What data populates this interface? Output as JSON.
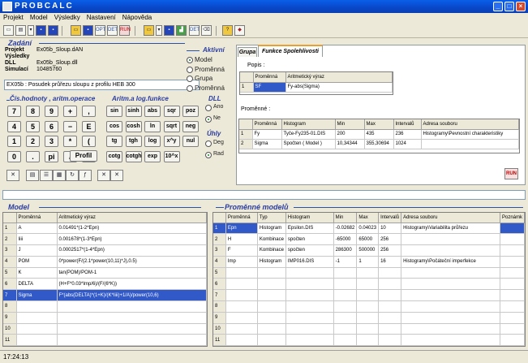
{
  "window": {
    "title": "PROBCALC",
    "min": "_",
    "max": "□",
    "close": "×"
  },
  "menu": [
    "Projekt",
    "Model",
    "Výsledky",
    "Nastavení",
    "Nápověda"
  ],
  "toolbar": [
    "new",
    "open",
    "dropdown",
    "save",
    "saveall",
    "open-folder",
    "save2",
    "opt",
    "det",
    "run",
    "folder2",
    "dropdown2",
    "save3",
    "chart",
    "det2",
    "clear",
    "help",
    "book"
  ],
  "toolbar_labels": {
    "opt": "OPT",
    "det": "DET",
    "run": "RUN",
    "det2": "DET"
  },
  "zadani": {
    "heading": "Zadání",
    "rows": [
      {
        "label": "Projekt",
        "value": "Ex05b_Sloup.dAN"
      },
      {
        "label": "Výsledky",
        "value": ""
      },
      {
        "label": "DLL",
        "value": "Ex05b_Sloup.dll"
      },
      {
        "label": "Simulací",
        "value": "10485760"
      }
    ],
    "description": "EX05b : Posudek průřezu sloupu z profilu HEB 300"
  },
  "aktivni": {
    "heading": "Aktivní",
    "options": [
      {
        "label": "Model",
        "on": true
      },
      {
        "label": "Proměnná",
        "on": false
      },
      {
        "label": "Grupa",
        "on": false
      },
      {
        "label": "Proměnná",
        "on": false
      }
    ]
  },
  "calc": {
    "heading": "Čís.hodnoty , aritm.operace",
    "keys": [
      "7",
      "8",
      "9",
      "+",
      ",",
      "4",
      "5",
      "6",
      "−",
      "E",
      "1",
      "2",
      "3",
      "*",
      "(",
      "0",
      ".",
      "pi",
      "/",
      ")"
    ],
    "profil": "Profil"
  },
  "funcs": {
    "heading": "Aritm.a log.funkce",
    "keys": [
      "sin",
      "sinh",
      "abs",
      "sqr",
      "poz",
      "cos",
      "cosh",
      "ln",
      "sqrt",
      "neg",
      "tg",
      "tgh",
      "log",
      "x^y",
      "nul",
      "cotg",
      "cotgh",
      "exp",
      "10^x"
    ]
  },
  "dll": {
    "heading": "DLL",
    "options": [
      {
        "label": "Ano",
        "on": false
      },
      {
        "label": "Ne",
        "on": true
      }
    ]
  },
  "uhly": {
    "heading": "Úhly",
    "options": [
      {
        "label": "Deg",
        "on": false
      },
      {
        "label": "Rad",
        "on": true
      }
    ]
  },
  "tabs": {
    "grupa": "Grupa",
    "funkce": "Funkce Spolehlivosti"
  },
  "popis": {
    "label": "Popis :",
    "headers": [
      "Proměnná",
      "Aritmetický výraz"
    ],
    "rows": [
      {
        "n": "1",
        "var": "SF",
        "expr": "Fy-abs(Sigma)"
      }
    ]
  },
  "promenne": {
    "label": "Proměnné :",
    "headers": [
      "Proměnná",
      "Histogram",
      "Min",
      "Max",
      "Intervalů",
      "Adresa souboru"
    ],
    "rows": [
      {
        "n": "1",
        "var": "Fy",
        "hist": "Tyče-Fy235-01.DIS",
        "min": "200",
        "max": "435",
        "int": "236",
        "addr": "Histogramy\\Pevnostní charakteristiky"
      },
      {
        "n": "2",
        "var": "Sigma",
        "hist": "Spočten ( Model )",
        "min": "10,34344",
        "max": "355,30694",
        "int": "1024",
        "addr": ""
      }
    ]
  },
  "run_label": "RUN",
  "model": {
    "heading": "Model",
    "headers": [
      "Proměnná",
      "Aritmetický výraz"
    ],
    "rows": [
      {
        "n": "1",
        "var": "A",
        "expr": "0.01491*(1-2*Epn)"
      },
      {
        "n": "2",
        "var": "Iiii",
        "expr": "0.001678*(1-3*Epn)"
      },
      {
        "n": "3",
        "var": "J",
        "expr": "0.0002517*(1-4*Epn)"
      },
      {
        "n": "4",
        "var": "POM",
        "expr": "0*power(F/(2.1*power(10,11)*J),0.5)"
      },
      {
        "n": "5",
        "var": "K",
        "expr": "tan(POM)/POM-1"
      },
      {
        "n": "6",
        "var": "DELTA",
        "expr": "(H+F*0.03*Imp/6)/(F/(6*K))"
      },
      {
        "n": "7",
        "var": "Sigma",
        "expr": "F*(abs(DELTA)*(1+K)/(K*Iiii)+1/A)/power(10,6)"
      },
      {
        "n": "8",
        "var": "",
        "expr": ""
      },
      {
        "n": "9",
        "var": "",
        "expr": ""
      },
      {
        "n": "10",
        "var": "",
        "expr": ""
      },
      {
        "n": "11",
        "var": "",
        "expr": ""
      }
    ],
    "selected": 6
  },
  "vars": {
    "heading": "Proměnné modelů",
    "headers": [
      "Proměnná",
      "Typ",
      "Histogram",
      "Min",
      "Max",
      "Intervalů",
      "Adresa souboru",
      "Poznámk"
    ],
    "rows": [
      {
        "n": "1",
        "var": "Epn",
        "typ": "Histogram",
        "hist": "Epsilon.DIS",
        "min": "-0.02682",
        "max": "0.04023",
        "int": "10",
        "addr": "Histogramy\\Variabilita průřezu"
      },
      {
        "n": "2",
        "var": "H",
        "typ": "Kombinace",
        "hist": "spočten",
        "min": "-65000",
        "max": "65000",
        "int": "256",
        "addr": ""
      },
      {
        "n": "3",
        "var": "F",
        "typ": "Kombinace",
        "hist": "spočten",
        "min": "286300",
        "max": "500000",
        "int": "256",
        "addr": ""
      },
      {
        "n": "4",
        "var": "Imp",
        "typ": "Histogram",
        "hist": "IMP016.DIS",
        "min": "-1",
        "max": "1",
        "int": "16",
        "addr": "Histogramy\\Počáteční imperfekce"
      },
      {
        "n": "5",
        "var": "",
        "typ": "",
        "hist": "",
        "min": "",
        "max": "",
        "int": "",
        "addr": ""
      },
      {
        "n": "6",
        "var": "",
        "typ": "",
        "hist": "",
        "min": "",
        "max": "",
        "int": "",
        "addr": ""
      },
      {
        "n": "7",
        "var": "",
        "typ": "",
        "hist": "",
        "min": "",
        "max": "",
        "int": "",
        "addr": ""
      },
      {
        "n": "8",
        "var": "",
        "typ": "",
        "hist": "",
        "min": "",
        "max": "",
        "int": "",
        "addr": ""
      },
      {
        "n": "9",
        "var": "",
        "typ": "",
        "hist": "",
        "min": "",
        "max": "",
        "int": "",
        "addr": ""
      },
      {
        "n": "10",
        "var": "",
        "typ": "",
        "hist": "",
        "min": "",
        "max": "",
        "int": "",
        "addr": ""
      },
      {
        "n": "11",
        "var": "",
        "typ": "",
        "hist": "",
        "min": "",
        "max": "",
        "int": "",
        "addr": ""
      }
    ],
    "selected": 0
  },
  "status": {
    "time": "17:24:13"
  }
}
